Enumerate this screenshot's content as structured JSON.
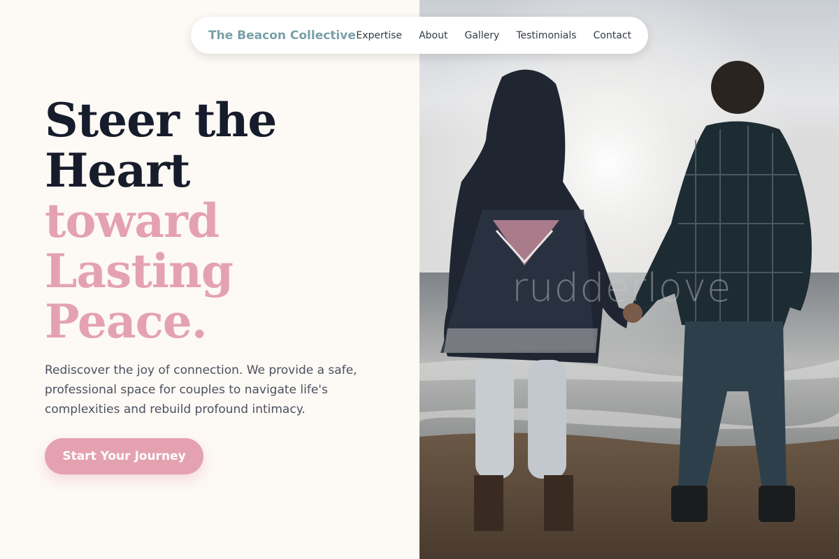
{
  "nav": {
    "brand": "The Beacon Collective",
    "links": [
      "Expertise",
      "About",
      "Gallery",
      "Testimonials",
      "Contact"
    ]
  },
  "hero": {
    "headline_dark": [
      "Steer the",
      "Heart"
    ],
    "headline_accent": [
      "toward",
      "Lasting",
      "Peace."
    ],
    "lead": "Rediscover the joy of connection. We provide a safe, professional space for couples to navigate life's complexities and rebuild profound intimacy.",
    "cta_label": "Start Your Journey"
  },
  "image": {
    "watermark": "rudderlove",
    "subject": "couple-holding-hands-beach-photo"
  },
  "colors": {
    "background": "#fdf9f4",
    "brand": "#7a9fa8",
    "heading_dark": "#161c2c",
    "accent_pink": "#e4a2b0",
    "body_text": "#4a5160"
  }
}
